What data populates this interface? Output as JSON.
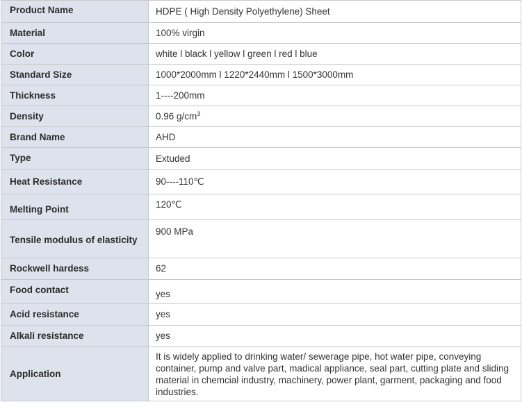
{
  "rows": [
    {
      "label": "Product Name",
      "value": "HDPE ( High Density  Polyethylene)  Sheet"
    },
    {
      "label": "Material",
      "value": "100% virgin"
    },
    {
      "label": "Color",
      "value": "white l black l yellow l green l red l blue"
    },
    {
      "label": "Standard Size",
      "value": "1000*2000mm l 1220*2440mm l 1500*3000mm"
    },
    {
      "label": "Thickness",
      "value": "1----200mm"
    },
    {
      "label": "Density",
      "value": "0.96 g/cm",
      "superscript": "3"
    },
    {
      "label": "Brand Name",
      "value": "AHD"
    },
    {
      "label": "Type",
      "value": "Extuded"
    },
    {
      "label": "Heat Resistance",
      "value": "90----110℃"
    },
    {
      "label": "Melting Point",
      "value": "120℃"
    },
    {
      "label": "Tensile modulus of elasticity",
      "value": "900 MPa"
    },
    {
      "label": "Rockwell hardess",
      "value": "62"
    },
    {
      "label": "Food contact",
      "value": "yes"
    },
    {
      "label": "Acid resistance",
      "value": "yes"
    },
    {
      "label": "Alkali resistance",
      "value": "yes"
    },
    {
      "label": "Application",
      "value": "It is widely applied to drinking water/ sewerage pipe, hot water pipe, conveying container, pump and valve part, madical appliance, seal part, cutting plate and sliding material in chemcial industry, machinery, power plant, garment, packaging and food industries."
    }
  ]
}
